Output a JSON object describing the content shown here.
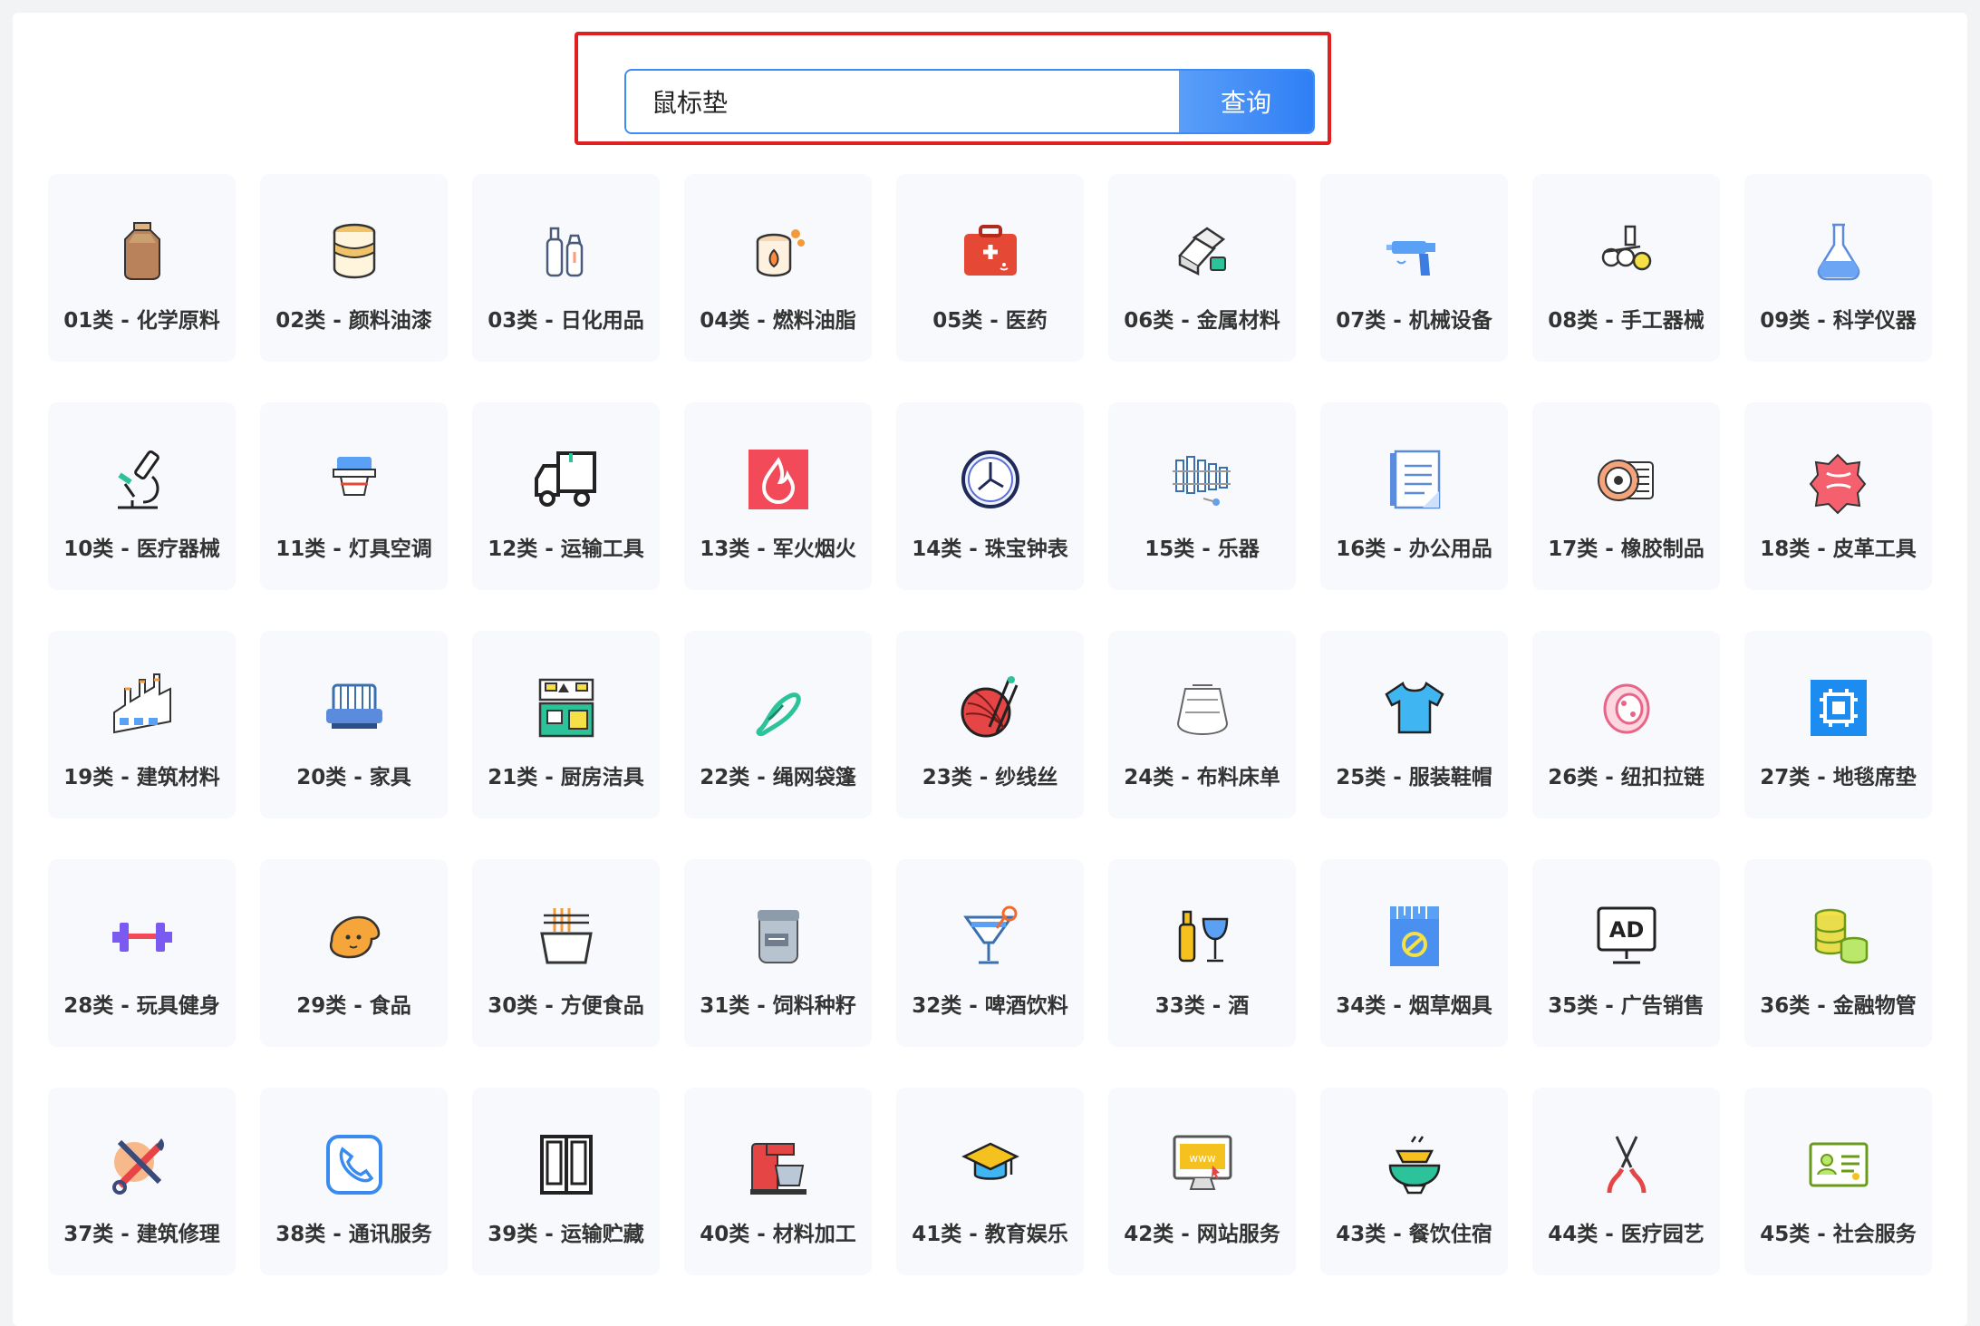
{
  "search": {
    "value": "鼠标垫",
    "button_label": "查询"
  },
  "categories": [
    {
      "label": "01类 - 化学原料",
      "icon": "chemical-bottle-icon"
    },
    {
      "label": "02类 - 颜料油漆",
      "icon": "paint-bucket-icon"
    },
    {
      "label": "03类 - 日化用品",
      "icon": "cosmetics-bottles-icon"
    },
    {
      "label": "04类 - 燃料油脂",
      "icon": "fuel-barrel-icon"
    },
    {
      "label": "05类 - 医药",
      "icon": "medical-kit-icon"
    },
    {
      "label": "06类 - 金属材料",
      "icon": "metal-ingots-icon"
    },
    {
      "label": "07类 - 机械设备",
      "icon": "electric-drill-icon"
    },
    {
      "label": "08类 - 手工器械",
      "icon": "hand-tools-icon"
    },
    {
      "label": "09类 - 科学仪器",
      "icon": "flask-icon"
    },
    {
      "label": "10类 - 医疗器械",
      "icon": "microscope-icon"
    },
    {
      "label": "11类 - 灯具空调",
      "icon": "lamp-icon"
    },
    {
      "label": "12类 - 运输工具",
      "icon": "truck-icon"
    },
    {
      "label": "13类 - 军火烟火",
      "icon": "fire-icon"
    },
    {
      "label": "14类 - 珠宝钟表",
      "icon": "clock-icon"
    },
    {
      "label": "15类 - 乐器",
      "icon": "xylophone-icon"
    },
    {
      "label": "16类 - 办公用品",
      "icon": "notepad-icon"
    },
    {
      "label": "17类 - 橡胶制品",
      "icon": "tape-roll-icon"
    },
    {
      "label": "18类 - 皮革工具",
      "icon": "leather-hide-icon"
    },
    {
      "label": "19类 - 建筑材料",
      "icon": "factory-icon"
    },
    {
      "label": "20类 - 家具",
      "icon": "sofa-icon"
    },
    {
      "label": "21类 - 厨房洁具",
      "icon": "kitchen-icon"
    },
    {
      "label": "22类 - 绳网袋篷",
      "icon": "rope-icon"
    },
    {
      "label": "23类 - 纱线丝",
      "icon": "yarn-ball-icon"
    },
    {
      "label": "24类 - 布料床单",
      "icon": "fabric-icon"
    },
    {
      "label": "25类 - 服装鞋帽",
      "icon": "tshirt-icon"
    },
    {
      "label": "26类 - 纽扣拉链",
      "icon": "button-icon"
    },
    {
      "label": "27类 - 地毯席垫",
      "icon": "carpet-icon"
    },
    {
      "label": "28类 - 玩具健身",
      "icon": "dumbbell-icon"
    },
    {
      "label": "29类 - 食品",
      "icon": "bread-icon"
    },
    {
      "label": "30类 - 方便食品",
      "icon": "noodle-bowl-icon"
    },
    {
      "label": "31类 - 饲料种籽",
      "icon": "feed-can-icon"
    },
    {
      "label": "32类 - 啤酒饮料",
      "icon": "cocktail-icon"
    },
    {
      "label": "33类 - 酒",
      "icon": "wine-icon"
    },
    {
      "label": "34类 - 烟草烟具",
      "icon": "cigarette-pack-icon"
    },
    {
      "label": "35类 - 广告销售",
      "icon": "ad-board-icon"
    },
    {
      "label": "36类 - 金融物管",
      "icon": "coins-icon"
    },
    {
      "label": "37类 - 建筑修理",
      "icon": "wrench-screwdriver-icon"
    },
    {
      "label": "38类 - 通讯服务",
      "icon": "phone-icon"
    },
    {
      "label": "39类 - 运输贮藏",
      "icon": "wardrobe-icon"
    },
    {
      "label": "40类 - 材料加工",
      "icon": "mixer-icon"
    },
    {
      "label": "41类 - 教育娱乐",
      "icon": "graduation-cap-icon"
    },
    {
      "label": "42类 - 网站服务",
      "icon": "website-monitor-icon"
    },
    {
      "label": "43类 - 餐饮住宿",
      "icon": "food-tray-icon"
    },
    {
      "label": "44类 - 医疗园艺",
      "icon": "pruning-shears-icon"
    },
    {
      "label": "45类 - 社会服务",
      "icon": "id-card-icon"
    }
  ]
}
